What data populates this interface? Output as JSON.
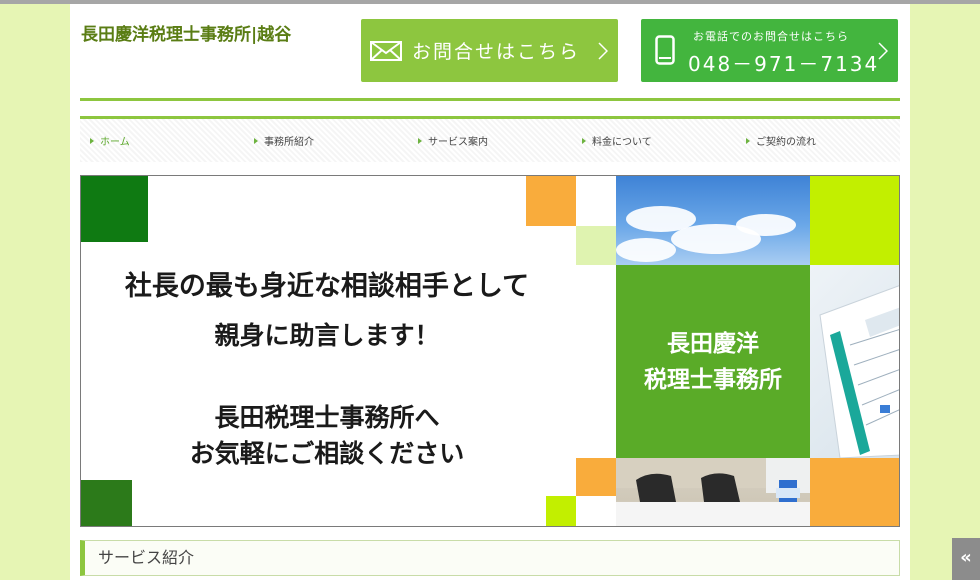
{
  "header": {
    "site_title": "長田慶洋税理士事務所|越谷",
    "contact_button": {
      "label": "お問合せはこちら"
    },
    "phone_button": {
      "label": "お電話でのお問合せはこちら",
      "number": "048－971－7134"
    }
  },
  "nav": {
    "items": [
      {
        "label": "ホーム",
        "active": true
      },
      {
        "label": "事務所紹介",
        "active": false
      },
      {
        "label": "サービス案内",
        "active": false
      },
      {
        "label": "料金について",
        "active": false
      },
      {
        "label": "ご契約の流れ",
        "active": false
      }
    ]
  },
  "hero": {
    "line1": "社長の最も身近な相談相手として",
    "line2": "親身に助言します！",
    "line3": "長田税理士事務所へ",
    "line4": "お気軽にご相談ください",
    "panel_line1": "長田慶洋",
    "panel_line2": "税理士事務所"
  },
  "section": {
    "title": "サービス紹介"
  },
  "scroll_top": {
    "label": "«"
  },
  "colors": {
    "accent": "#8dc63f",
    "phone_green": "#43b53e",
    "title_green": "#5a7d14",
    "page_bg": "#e6f5b4",
    "dark_green": "#0f7a12",
    "orange": "#f9ac3c",
    "lime": "#c2ef00"
  },
  "icons": {
    "contact": "envelope-icon",
    "phone": "mobile-phone-icon",
    "arrow": "chevron-right-icon"
  }
}
